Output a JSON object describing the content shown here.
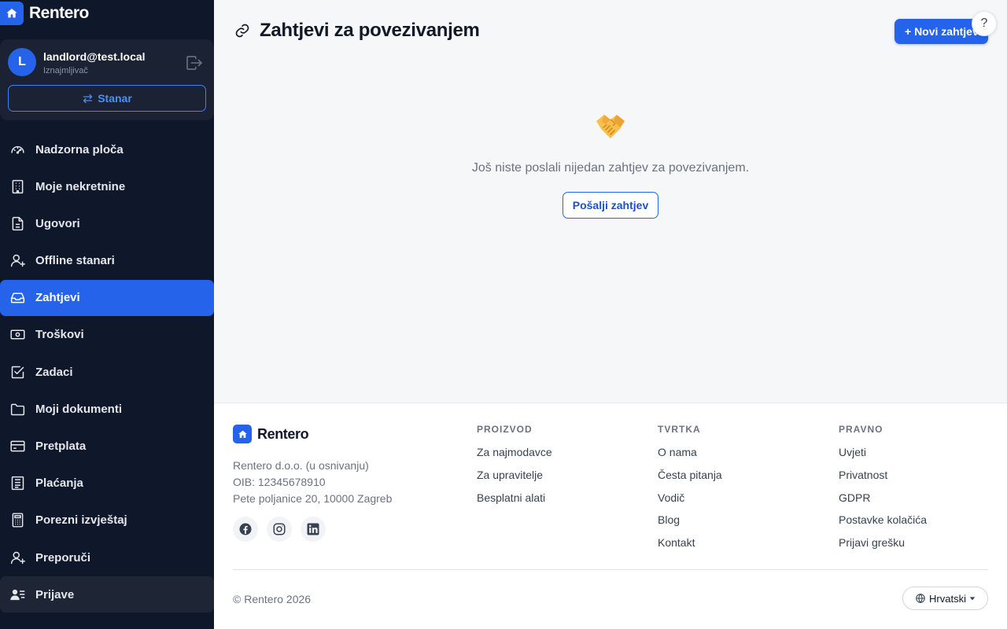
{
  "brand": {
    "name": "Rentero"
  },
  "user": {
    "initial": "L",
    "email": "landlord@test.local",
    "role": "Iznajmljivač",
    "switch_label": "Stanar"
  },
  "nav": {
    "items": [
      {
        "label": "Nadzorna ploča",
        "icon": "dashboard-gauge-icon"
      },
      {
        "label": "Moje nekretnine",
        "icon": "building-icon"
      },
      {
        "label": "Ugovori",
        "icon": "document-icon"
      },
      {
        "label": "Offline stanari",
        "icon": "user-plus-icon"
      },
      {
        "label": "Zahtjevi",
        "icon": "inbox-icon",
        "active": true
      },
      {
        "label": "Troškovi",
        "icon": "banknote-icon"
      },
      {
        "label": "Zadaci",
        "icon": "checkbox-icon"
      },
      {
        "label": "Moji dokumenti",
        "icon": "folder-icon"
      },
      {
        "label": "Pretplata",
        "icon": "credit-card-icon"
      },
      {
        "label": "Plaćanja",
        "icon": "receipt-icon"
      },
      {
        "label": "Porezni izvještaj",
        "icon": "calculator-icon"
      },
      {
        "label": "Preporuči",
        "icon": "user-plus-icon"
      },
      {
        "label": "Prijave",
        "icon": "user-list-icon",
        "hovered": true
      }
    ]
  },
  "page": {
    "title": "Zahtjevi za povezivanjem",
    "title_icon": "link-icon",
    "new_button": "+ Novi zahtjev",
    "help": "?"
  },
  "empty_state": {
    "emoji": "handshake",
    "message": "Još niste poslali nijedan zahtjev za povezivanjem.",
    "button": "Pošalji zahtjev"
  },
  "footer": {
    "brand": "Rentero",
    "company": "Rentero d.o.o. (u osnivanju)",
    "oib": "OIB: 12345678910",
    "address": "Pete poljanice 20, 10000 Zagreb",
    "social": [
      "facebook-icon",
      "instagram-icon",
      "linkedin-icon"
    ],
    "columns": [
      {
        "heading": "PROIZVOD",
        "links": [
          "Za najmodavce",
          "Za upravitelje",
          "Besplatni alati"
        ]
      },
      {
        "heading": "TVRTKA",
        "links": [
          "O nama",
          "Česta pitanja",
          "Vodič",
          "Blog",
          "Kontakt"
        ]
      },
      {
        "heading": "PRAVNO",
        "links": [
          "Uvjeti",
          "Privatnost",
          "GDPR",
          "Postavke kolačića",
          "Prijavi grešku"
        ]
      }
    ],
    "copyright": "© Rentero 2026",
    "language": "Hrvatski"
  },
  "colors": {
    "sidebar_bg": "#0f172a",
    "accent": "#2563eb",
    "page_bg": "#f6f7f9"
  }
}
